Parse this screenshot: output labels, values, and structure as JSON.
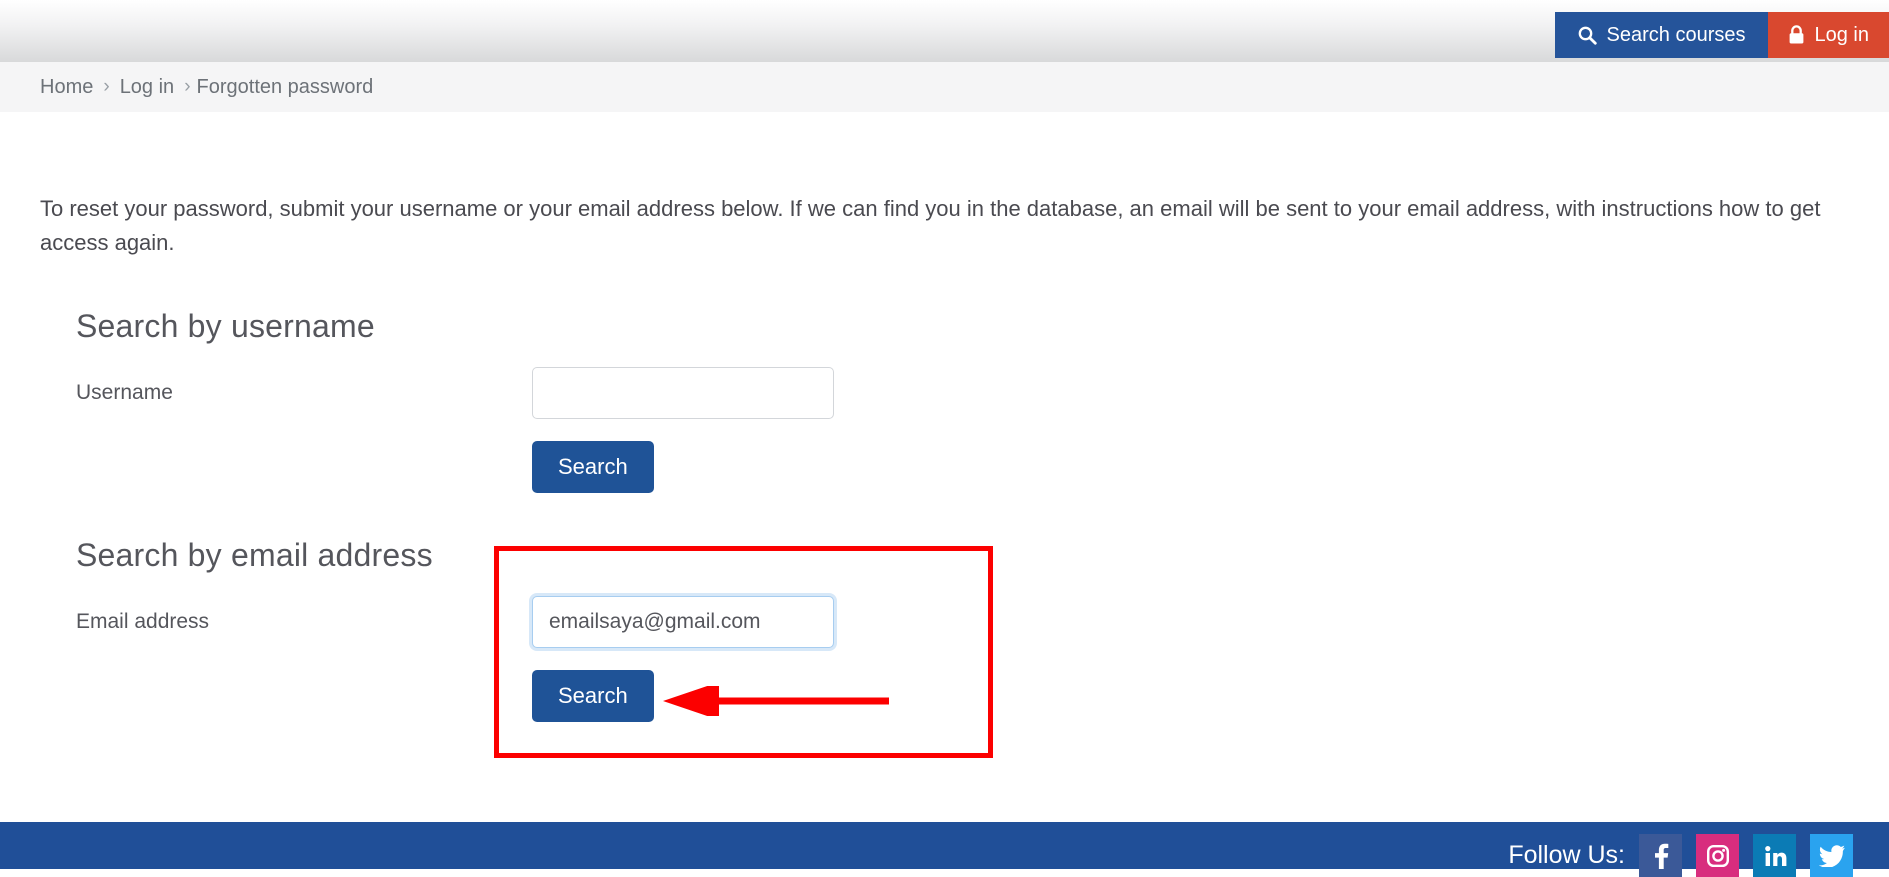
{
  "colors": {
    "brand_blue": "#25549a",
    "button_blue": "#1f5397",
    "login_red": "#d9482f",
    "annotation_red": "#fc0000",
    "footer_blue": "#204f98",
    "facebook": "#3b5998",
    "instagram": "#d82d7e",
    "linkedin": "#0b7bb5",
    "twitter": "#2aa3ef",
    "focus_border": "#a7cdf0"
  },
  "topbar": {
    "search_courses_label": "Search courses",
    "search_courses_icon": "search-icon",
    "login_label": "Log in",
    "login_icon": "lock-icon"
  },
  "breadcrumb": {
    "items": [
      {
        "label": "Home"
      },
      {
        "label": "Log in"
      },
      {
        "label": "Forgotten password"
      }
    ],
    "separator": "›"
  },
  "main": {
    "intro": "To reset your password, submit your username or your email address below. If we can find you in the database, an email will be sent to your email address, with instructions how to get access again.",
    "username_section": {
      "heading": "Search by username",
      "label": "Username",
      "value": "",
      "placeholder": "",
      "button_label": "Search"
    },
    "email_section": {
      "heading": "Search by email address",
      "label": "Email address",
      "value": "emailsaya@gmail.com",
      "placeholder": "",
      "button_label": "Search"
    }
  },
  "annotation": {
    "highlight_box": "red rectangle around email search form",
    "arrow": "red left-pointing arrow at email Search button"
  },
  "footer": {
    "follow_label": "Follow Us:",
    "social": [
      {
        "name": "facebook",
        "glyph": "f"
      },
      {
        "name": "instagram",
        "glyph": "▢"
      },
      {
        "name": "linkedin",
        "glyph": "in"
      },
      {
        "name": "twitter",
        "glyph": "ᴠ"
      }
    ]
  }
}
